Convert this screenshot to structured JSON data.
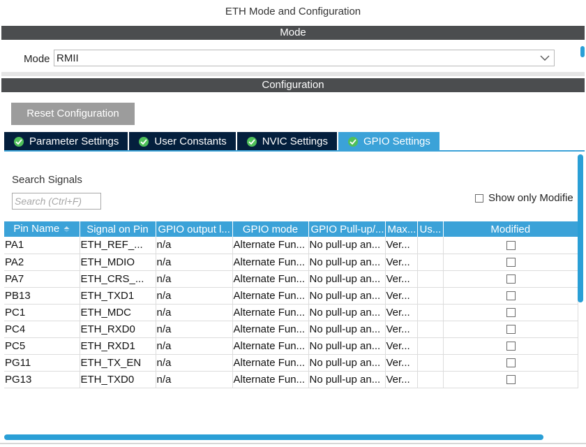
{
  "window": {
    "title": "ETH Mode and Configuration"
  },
  "mode_section": {
    "header": "Mode",
    "label": "Mode",
    "value": "RMII"
  },
  "config_section": {
    "header": "Configuration",
    "reset_label": "Reset Configuration",
    "tabs": [
      {
        "label": "Parameter Settings",
        "active": false
      },
      {
        "label": "User Constants",
        "active": false
      },
      {
        "label": "NVIC Settings",
        "active": false
      },
      {
        "label": "GPIO Settings",
        "active": true
      }
    ]
  },
  "search": {
    "label": "Search Signals",
    "placeholder": "Search (Ctrl+F)"
  },
  "show_only_modified": {
    "label": "Show only Modifie",
    "checked": false
  },
  "table": {
    "columns": [
      "Pin Name",
      "Signal on Pin",
      "GPIO output l...",
      "GPIO mode",
      "GPIO Pull-up/...",
      "Max...",
      "Us...",
      "Modified"
    ],
    "rows": [
      [
        "PA1",
        "ETH_REF_...",
        "n/a",
        "Alternate Fun...",
        "No pull-up an...",
        "Ver...",
        "",
        false
      ],
      [
        "PA2",
        "ETH_MDIO",
        "n/a",
        "Alternate Fun...",
        "No pull-up an...",
        "Ver...",
        "",
        false
      ],
      [
        "PA7",
        "ETH_CRS_...",
        "n/a",
        "Alternate Fun...",
        "No pull-up an...",
        "Ver...",
        "",
        false
      ],
      [
        "PB13",
        "ETH_TXD1",
        "n/a",
        "Alternate Fun...",
        "No pull-up an...",
        "Ver...",
        "",
        false
      ],
      [
        "PC1",
        "ETH_MDC",
        "n/a",
        "Alternate Fun...",
        "No pull-up an...",
        "Ver...",
        "",
        false
      ],
      [
        "PC4",
        "ETH_RXD0",
        "n/a",
        "Alternate Fun...",
        "No pull-up an...",
        "Ver...",
        "",
        false
      ],
      [
        "PC5",
        "ETH_RXD1",
        "n/a",
        "Alternate Fun...",
        "No pull-up an...",
        "Ver...",
        "",
        false
      ],
      [
        "PG11",
        "ETH_TX_EN",
        "n/a",
        "Alternate Fun...",
        "No pull-up an...",
        "Ver...",
        "",
        false
      ],
      [
        "PG13",
        "ETH_TXD0",
        "n/a",
        "Alternate Fun...",
        "No pull-up an...",
        "Ver...",
        "",
        false
      ]
    ]
  },
  "icons": {
    "tab_status": "check-circle-icon",
    "dropdown": "chevron-down-icon",
    "sort": "sort-ascending-icon"
  },
  "colors": {
    "section_bar": "#4b4d4f",
    "tab_inactive": "#041f3d",
    "tab_active": "#3ba2d8",
    "accent": "#2a9fd6",
    "check_green": "#4fc05a"
  }
}
